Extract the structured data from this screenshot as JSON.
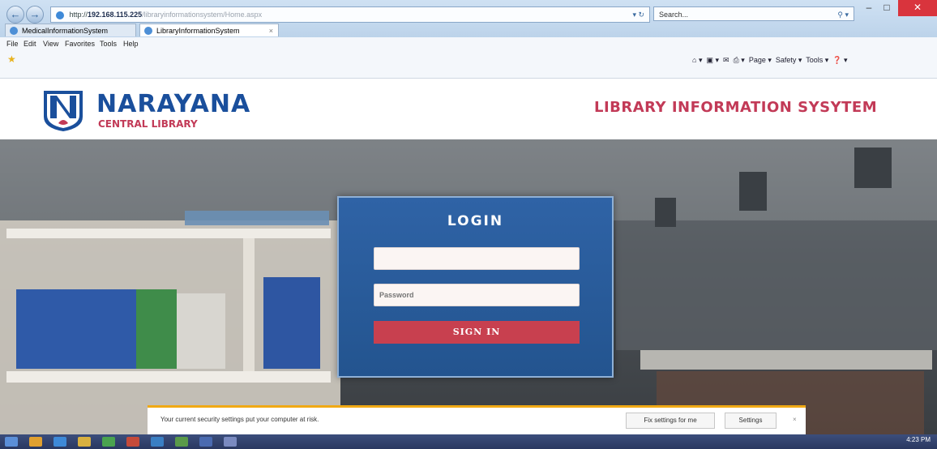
{
  "browser": {
    "address_prefix": "http://",
    "address_host": "192.168.115.225",
    "address_path": "/libraryinformationsystem/Home.aspx",
    "search_placeholder": "Search...",
    "tabs": [
      {
        "label": "MedicalInformationSystem"
      },
      {
        "label": "LibraryInformationSystem"
      }
    ],
    "menu": [
      "File",
      "Edit",
      "View",
      "Favorites",
      "Tools",
      "Help"
    ],
    "command_bar": [
      "Page",
      "Safety",
      "Tools"
    ]
  },
  "header": {
    "brand_name": "NARAYANA",
    "brand_subtitle": "CENTRAL LIBRARY",
    "app_title": "LIBRARY INFORMATION SYSYTEM"
  },
  "login": {
    "title": "LOGIN",
    "username_placeholder": "",
    "password_placeholder": "Password",
    "submit_label": "SIGN IN"
  },
  "security_bar": {
    "message": "Your current security settings put your computer at risk.",
    "fix_label": "Fix settings for me",
    "settings_label": "Settings"
  },
  "taskbar": {
    "clock": "4:23 PM"
  },
  "colors": {
    "brand_blue": "#1a4f9c",
    "brand_red": "#c23a57",
    "login_panel": "#2b5d9f",
    "signin_button": "#c8404f"
  }
}
